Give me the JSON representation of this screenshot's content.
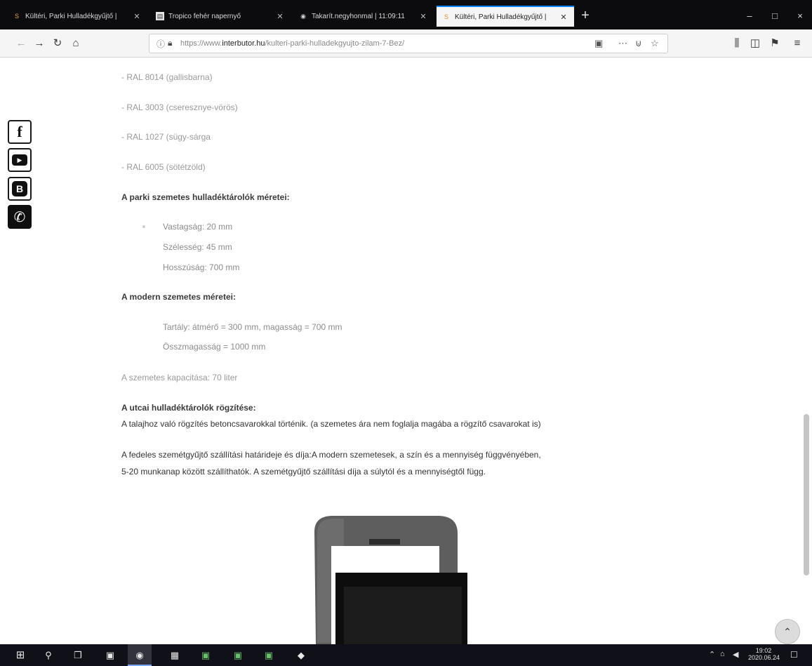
{
  "browser": {
    "tabs": [
      {
        "label": "Kültéri, Parki Hulladékgyűjtő |",
        "icon": "site-favicon"
      },
      {
        "label": "Tropico fehér napernyő",
        "icon": "site-favicon"
      },
      {
        "label": "Takarít.negyhonmal | 11:09:11",
        "icon": "chrome-favicon"
      },
      {
        "label": "Kültéri, Parki Hulladékgyűjtő |",
        "icon": "site-favicon"
      }
    ],
    "active_tab": 3,
    "new_tab_label": "+",
    "window_controls": {
      "minimize": "–",
      "maximize": "□",
      "close": "×"
    },
    "url_prefix": "https://www.",
    "url_domain": "interbutor.hu",
    "url_path": "/kulteri-parki-hulladekgyujto-zilam-7-Bez/",
    "more_icon": "⋯"
  },
  "social": [
    {
      "name": "facebook",
      "glyph": "f"
    },
    {
      "name": "youtube",
      "glyph": "▶"
    },
    {
      "name": "blogger",
      "glyph": "B"
    },
    {
      "name": "phone",
      "glyph": "✆"
    }
  ],
  "content": {
    "colors": [
      "- RAL 8014 (gallisbarna)",
      "- RAL 3003 (cseresznye-vörös)",
      "- RAL 1027 (sügy-sárga",
      "- RAL 6005 (sötétzöld)"
    ],
    "park_heading": "A parki szemetes hulladéktárolók méretei:",
    "park_sizes": [
      "Vastagság: 20 mm",
      "Szélesség: 45 mm",
      "Hosszúság: 700 mm"
    ],
    "modern_heading": "A modern szemetes méretei:",
    "modern_sizes": [
      "Tartály: átmérő = 300 mm, magasság = 700 mm",
      "Összmagasság = 1000 mm"
    ],
    "capacity": "A szemetes kapacitása: 70 liter",
    "fixing_heading": "A utcai hulladéktárolók rögzítése:",
    "fixing_text": "A talajhoz való rögzítés betoncsavarokkal történik. (a szemetes ára nem foglalja magába a rögzítő csavarokat is)",
    "delivery_line1": "A fedeles szemétgyűjtő szállítási határideje és díja:A modern szemetesek, a szín és a mennyiség függvényében,",
    "delivery_line2": "5-20 munkanap között szállíthatók. A szemétgyűjtő szállítási díja a súlytól és a mennyiségtől függ."
  },
  "back_to_top": "⌃",
  "taskbar": {
    "start_icon": "windows-start",
    "clock_time": "19:02",
    "clock_date": "2020.06.24"
  }
}
